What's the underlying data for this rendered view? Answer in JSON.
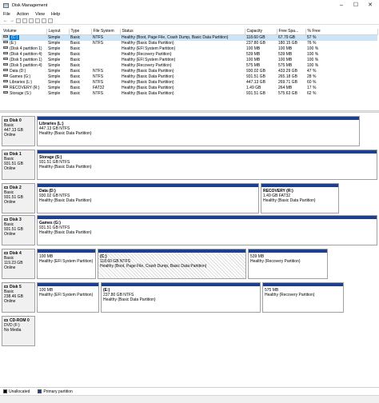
{
  "window": {
    "title": "Disk Management",
    "min": "–",
    "max": "☐",
    "close": "✕"
  },
  "menu": [
    "File",
    "Action",
    "View",
    "Help"
  ],
  "table": {
    "headers": [
      "Volume",
      "Layout",
      "Type",
      "File System",
      "Status",
      "Capacity",
      "Free Spa...",
      "% Free"
    ],
    "rows": [
      [
        "(C:)",
        "Simple",
        "Basic",
        "NTFS",
        "Healthy (Boot, Page File, Crash Dump, Basic Data Partition)",
        "118.60 GB",
        "67.79 GB",
        "57 %"
      ],
      [
        "(E:)",
        "Simple",
        "Basic",
        "NTFS",
        "Healthy (Basic Data Partition)",
        "237.80 GB",
        "180.15 GB",
        "76 %"
      ],
      [
        "(Disk 4 partition 1)",
        "Simple",
        "Basic",
        "",
        "Healthy (EFI System Partition)",
        "100 MB",
        "100 MB",
        "100 %"
      ],
      [
        "(Disk 4 partition 4)",
        "Simple",
        "Basic",
        "",
        "Healthy (Recovery Partition)",
        "539 MB",
        "539 MB",
        "100 %"
      ],
      [
        "(Disk 5 partition 1)",
        "Simple",
        "Basic",
        "",
        "Healthy (EFI System Partition)",
        "100 MB",
        "100 MB",
        "100 %"
      ],
      [
        "(Disk 5 partition 4)",
        "Simple",
        "Basic",
        "",
        "Healthy (Recovery Partition)",
        "575 MB",
        "575 MB",
        "100 %"
      ],
      [
        "Data (D:)",
        "Simple",
        "Basic",
        "NTFS",
        "Healthy (Basic Data Partition)",
        "930.02 GB",
        "433.29 GB",
        "47 %"
      ],
      [
        "Games (G:)",
        "Simple",
        "Basic",
        "NTFS",
        "Healthy (Basic Data Partition)",
        "931.51 GB",
        "265.18 GB",
        "28 %"
      ],
      [
        "Libraries (L:)",
        "Simple",
        "Basic",
        "NTFS",
        "Healthy (Basic Data Partition)",
        "447.13 GB",
        "269.71 GB",
        "60 %"
      ],
      [
        "RECOVERY (R:)",
        "Simple",
        "Basic",
        "FAT32",
        "Healthy (Basic Data Partition)",
        "1.49 GB",
        "264 MB",
        "17 %"
      ],
      [
        "Storage (S:)",
        "Simple",
        "Basic",
        "NTFS",
        "Healthy (Basic Data Partition)",
        "931.51 GB",
        "575.63 GB",
        "62 %"
      ]
    ]
  },
  "disks": [
    {
      "name": "Disk 0",
      "type": "Basic",
      "size": "447.13 GB",
      "status": "Online",
      "partitions": [
        {
          "name": "Libraries (L:)",
          "size": "447.13 GB NTFS",
          "status": "Healthy (Basic Data Partition)"
        }
      ]
    },
    {
      "name": "Disk 1",
      "type": "Basic",
      "size": "931.51 GB",
      "status": "Online",
      "partitions": [
        {
          "name": "Storage (S:)",
          "size": "931.51 GB NTFS",
          "status": "Healthy (Basic Data Partition)"
        }
      ]
    },
    {
      "name": "Disk 2",
      "type": "Basic",
      "size": "931.51 GB",
      "status": "Online",
      "partitions": [
        {
          "name": "Data (D:)",
          "size": "930.02 GB NTFS",
          "status": "Healthy (Basic Data Partition)"
        },
        {
          "name": "RECOVERY (R:)",
          "size": "1.49 GB FAT32",
          "status": "Healthy (Basic Data Partition)"
        }
      ]
    },
    {
      "name": "Disk 3",
      "type": "Basic",
      "size": "931.51 GB",
      "status": "Online",
      "partitions": [
        {
          "name": "Games (G:)",
          "size": "931.51 GB NTFS",
          "status": "Healthy (Basic Data Partition)"
        }
      ]
    },
    {
      "name": "Disk 4",
      "type": "Basic",
      "size": "119.23 GB",
      "status": "Online",
      "partitions": [
        {
          "name": "",
          "size": "100 MB",
          "status": "Healthy (EFI System Partition)"
        },
        {
          "name": "(C:)",
          "size": "118.60 GB NTFS",
          "status": "Healthy (Boot, Page File, Crash Dump, Basic Data Partition)"
        },
        {
          "name": "",
          "size": "539 MB",
          "status": "Healthy (Recovery Partition)"
        }
      ]
    },
    {
      "name": "Disk 5",
      "type": "Basic",
      "size": "238.46 GB",
      "status": "Online",
      "partitions": [
        {
          "name": "",
          "size": "100 MB",
          "status": "Healthy (EFI System Partition)"
        },
        {
          "name": "(E:)",
          "size": "237.80 GB NTFS",
          "status": "Healthy (Basic Data Partition)"
        },
        {
          "name": "",
          "size": "575 MB",
          "status": "Healthy (Recovery Partition)"
        }
      ]
    },
    {
      "name": "CD-ROM 0",
      "type": "DVD (F:)",
      "size": "",
      "status": "No Media",
      "partitions": []
    }
  ],
  "legend": {
    "unallocated": "Unallocated",
    "primary": "Primary partition",
    "unallocated_color": "#000000",
    "primary_color": "#1d3f8f"
  }
}
